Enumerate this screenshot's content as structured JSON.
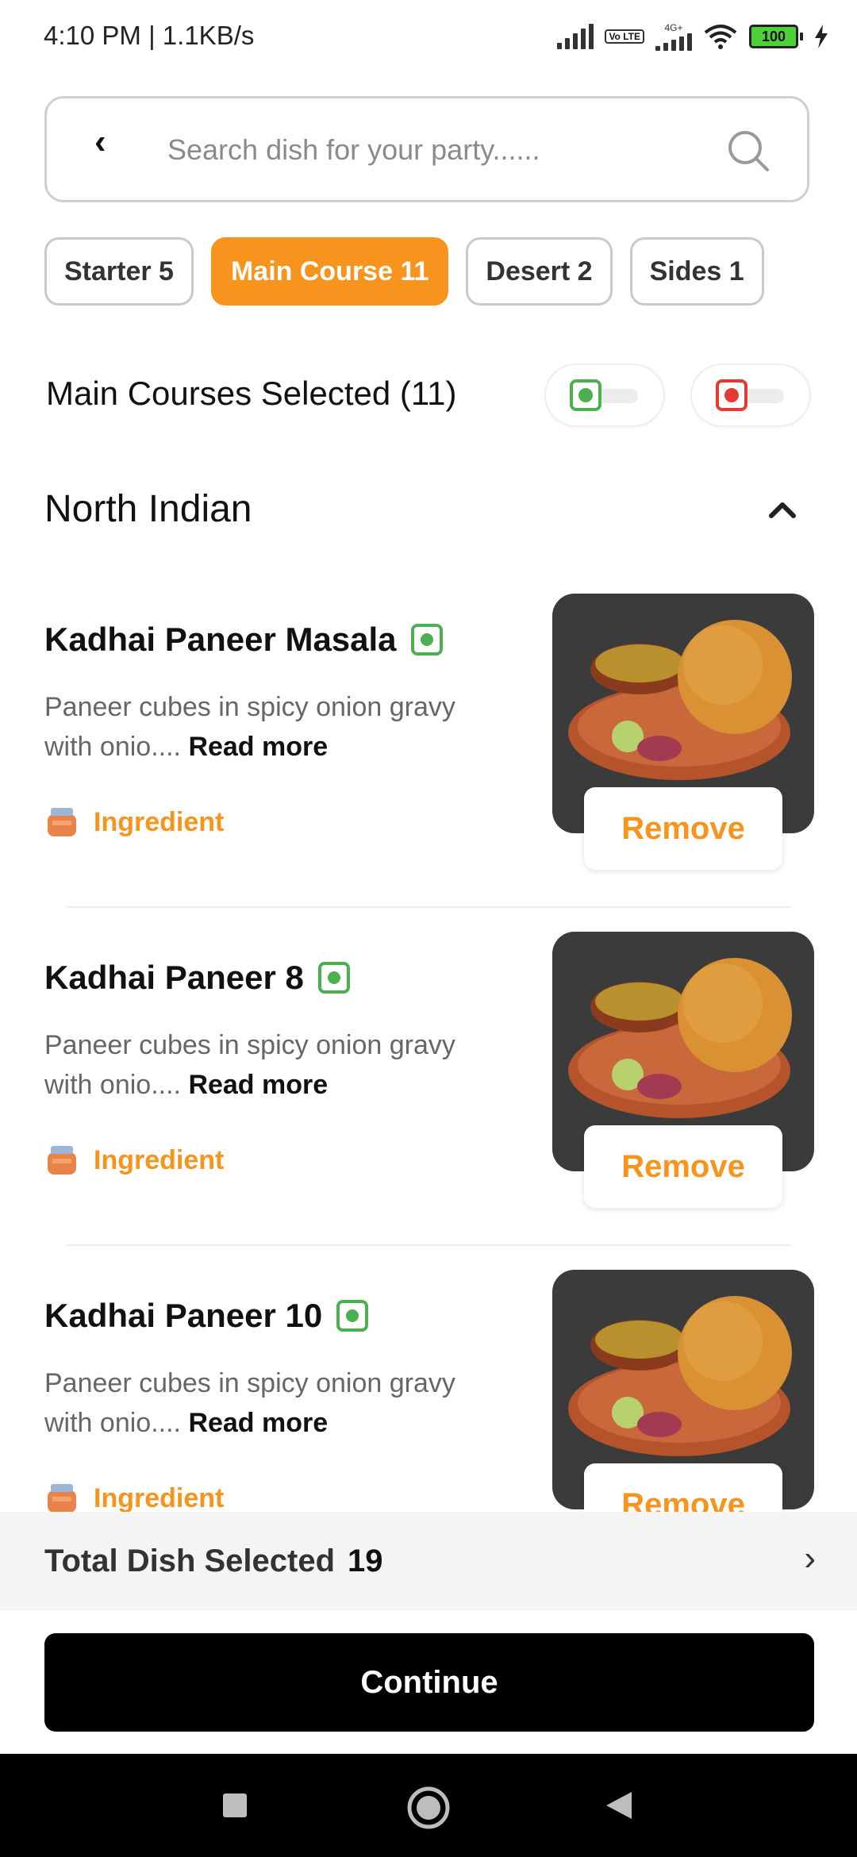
{
  "status_bar": {
    "time": "4:10 PM | 1.1KB/s",
    "network_type": "4G+",
    "volte": "Vo LTE",
    "battery": "100"
  },
  "search": {
    "placeholder": "Search dish for your party......"
  },
  "tabs": [
    {
      "label": "Starter 5",
      "active": false
    },
    {
      "label": "Main Course 11",
      "active": true
    },
    {
      "label": "Desert 2",
      "active": false
    },
    {
      "label": "Sides 1",
      "active": false
    }
  ],
  "selected_heading": "Main Courses Selected (11)",
  "filters": {
    "veg_color": "#4caf50",
    "nonveg_color": "#e53935"
  },
  "section": {
    "title": "North Indian"
  },
  "dishes": [
    {
      "name": "Kadhai Paneer Masala",
      "description": "Paneer cubes in spicy onion gravy with onio....",
      "read_more": "Read more",
      "ingredient_label": "Ingredient",
      "remove_label": "Remove"
    },
    {
      "name": "Kadhai Paneer 8",
      "description": "Paneer cubes in spicy onion gravy with onio....",
      "read_more": "Read more",
      "ingredient_label": "Ingredient",
      "remove_label": "Remove"
    },
    {
      "name": "Kadhai Paneer 10",
      "description": "Paneer cubes in spicy onion gravy with onio....",
      "read_more": "Read more",
      "ingredient_label": "Ingredient",
      "remove_label": "Remove"
    }
  ],
  "total": {
    "label": "Total Dish Selected",
    "count": "19",
    "arrow": "›"
  },
  "continue_label": "Continue",
  "accent_color": "#f7941d"
}
